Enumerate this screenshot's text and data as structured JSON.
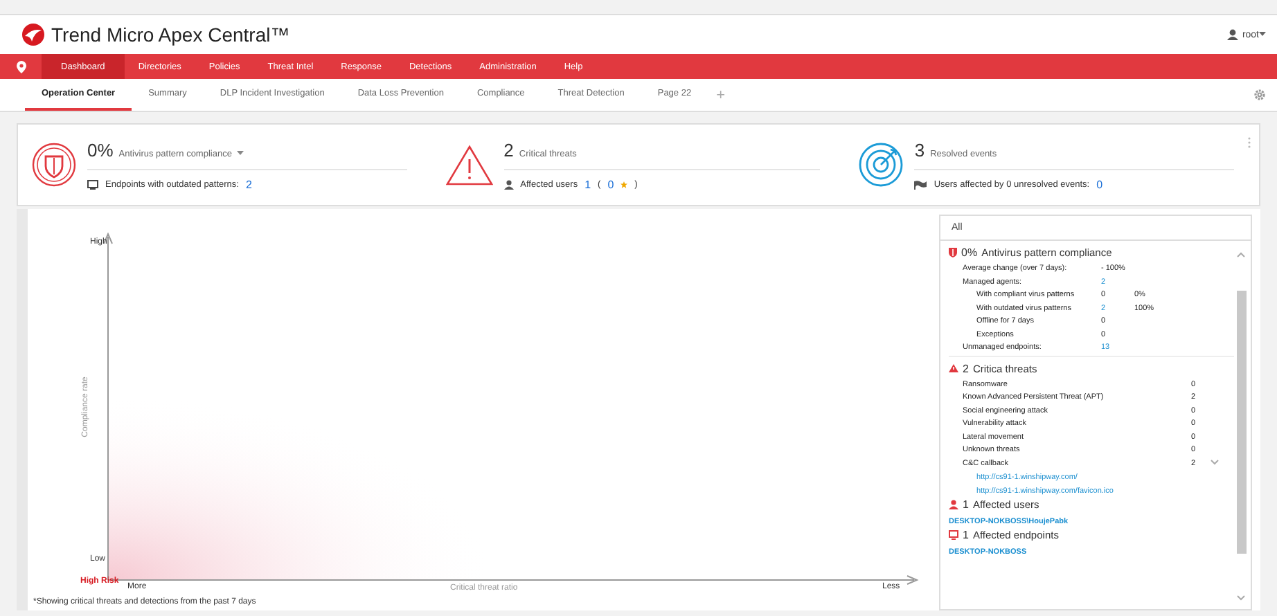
{
  "app": {
    "title": "Trend Micro Apex Central™",
    "user": "root"
  },
  "nav": [
    {
      "label": "Dashboard",
      "selected": true
    },
    {
      "label": "Directories",
      "selected": false
    },
    {
      "label": "Policies",
      "selected": false
    },
    {
      "label": "Threat Intel",
      "selected": false
    },
    {
      "label": "Response",
      "selected": false
    },
    {
      "label": "Detections",
      "selected": false
    },
    {
      "label": "Administration",
      "selected": false
    },
    {
      "label": "Help",
      "selected": false
    }
  ],
  "tabs": [
    {
      "label": "Operation Center",
      "selected": true
    },
    {
      "label": "Summary",
      "selected": false
    },
    {
      "label": "DLP Incident Investigation",
      "selected": false
    },
    {
      "label": "Data Loss Prevention",
      "selected": false
    },
    {
      "label": "Compliance",
      "selected": false
    },
    {
      "label": "Threat Detection",
      "selected": false
    },
    {
      "label": "Page 22",
      "selected": false
    }
  ],
  "add_tab": "+",
  "summary": [
    {
      "kind": "compliance",
      "value": "0%",
      "title": "Antivirus pattern compliance",
      "detail": "Endpoints with outdated patterns:",
      "count": "2"
    },
    {
      "kind": "threats",
      "value": "2",
      "title": "Critical threats",
      "detail": "Affected users",
      "count": "1",
      "open": "(",
      "sub": "0",
      "close": ")"
    },
    {
      "kind": "resolved",
      "value": "3",
      "title": "Resolved events",
      "detail": "Users affected by 0 unresolved events:",
      "count": "0"
    }
  ],
  "chart": {
    "y_high": "High",
    "y_low": "Low",
    "y_title": "Compliance rate",
    "x_start": "More",
    "x_title": "Critical threat ratio",
    "x_end": "Less",
    "corner": "High Risk",
    "note": "*Showing critical threats and detections from the past 7 days"
  },
  "panel": {
    "filter": "All",
    "sections": [
      {
        "kind": "compliance",
        "value": "0%",
        "title": "Antivirus pattern compliance",
        "rows": [
          {
            "label": "Average change (over 7 days):",
            "value": "- 100%"
          },
          {
            "label": "Managed agents:",
            "value": "2",
            "link": true,
            "children": [
              {
                "label": "With compliant virus patterns",
                "value": "0",
                "extra": "0%"
              },
              {
                "label": "With outdated virus patterns",
                "value": "2",
                "extra": "100%",
                "link": true
              },
              {
                "label": "Offline for 7 days",
                "value": "0"
              },
              {
                "label": "Exceptions",
                "value": "0"
              }
            ]
          },
          {
            "label": "Unmanaged endpoints:",
            "value": "13",
            "link": true
          }
        ]
      },
      {
        "kind": "threats",
        "value": "2",
        "title": "Critica threats",
        "rows": [
          {
            "label": "Ransomware",
            "value": "0"
          },
          {
            "label": "Known Advanced Persistent Threat (APT)",
            "value": "2"
          },
          {
            "label": "Social engineering attack",
            "value": "0"
          },
          {
            "label": "Vulnerability attack",
            "value": "0"
          },
          {
            "label": "Lateral movement",
            "value": "0"
          },
          {
            "label": "Unknown threats",
            "value": "0"
          },
          {
            "label": "C&C callback",
            "value": "2",
            "expanded": true,
            "links": [
              "http://cs91-1.winshipway.com/",
              "http://cs91-1.winshipway.com/favicon.ico"
            ]
          }
        ]
      },
      {
        "kind": "users",
        "value": "1",
        "title": "Affected users",
        "links": [
          "DESKTOP-NOKBOSS\\HoujePabk"
        ]
      },
      {
        "kind": "endpoints",
        "value": "1",
        "title": "Affected endpoints",
        "links": [
          "DESKTOP-NOKBOSS"
        ]
      }
    ]
  }
}
